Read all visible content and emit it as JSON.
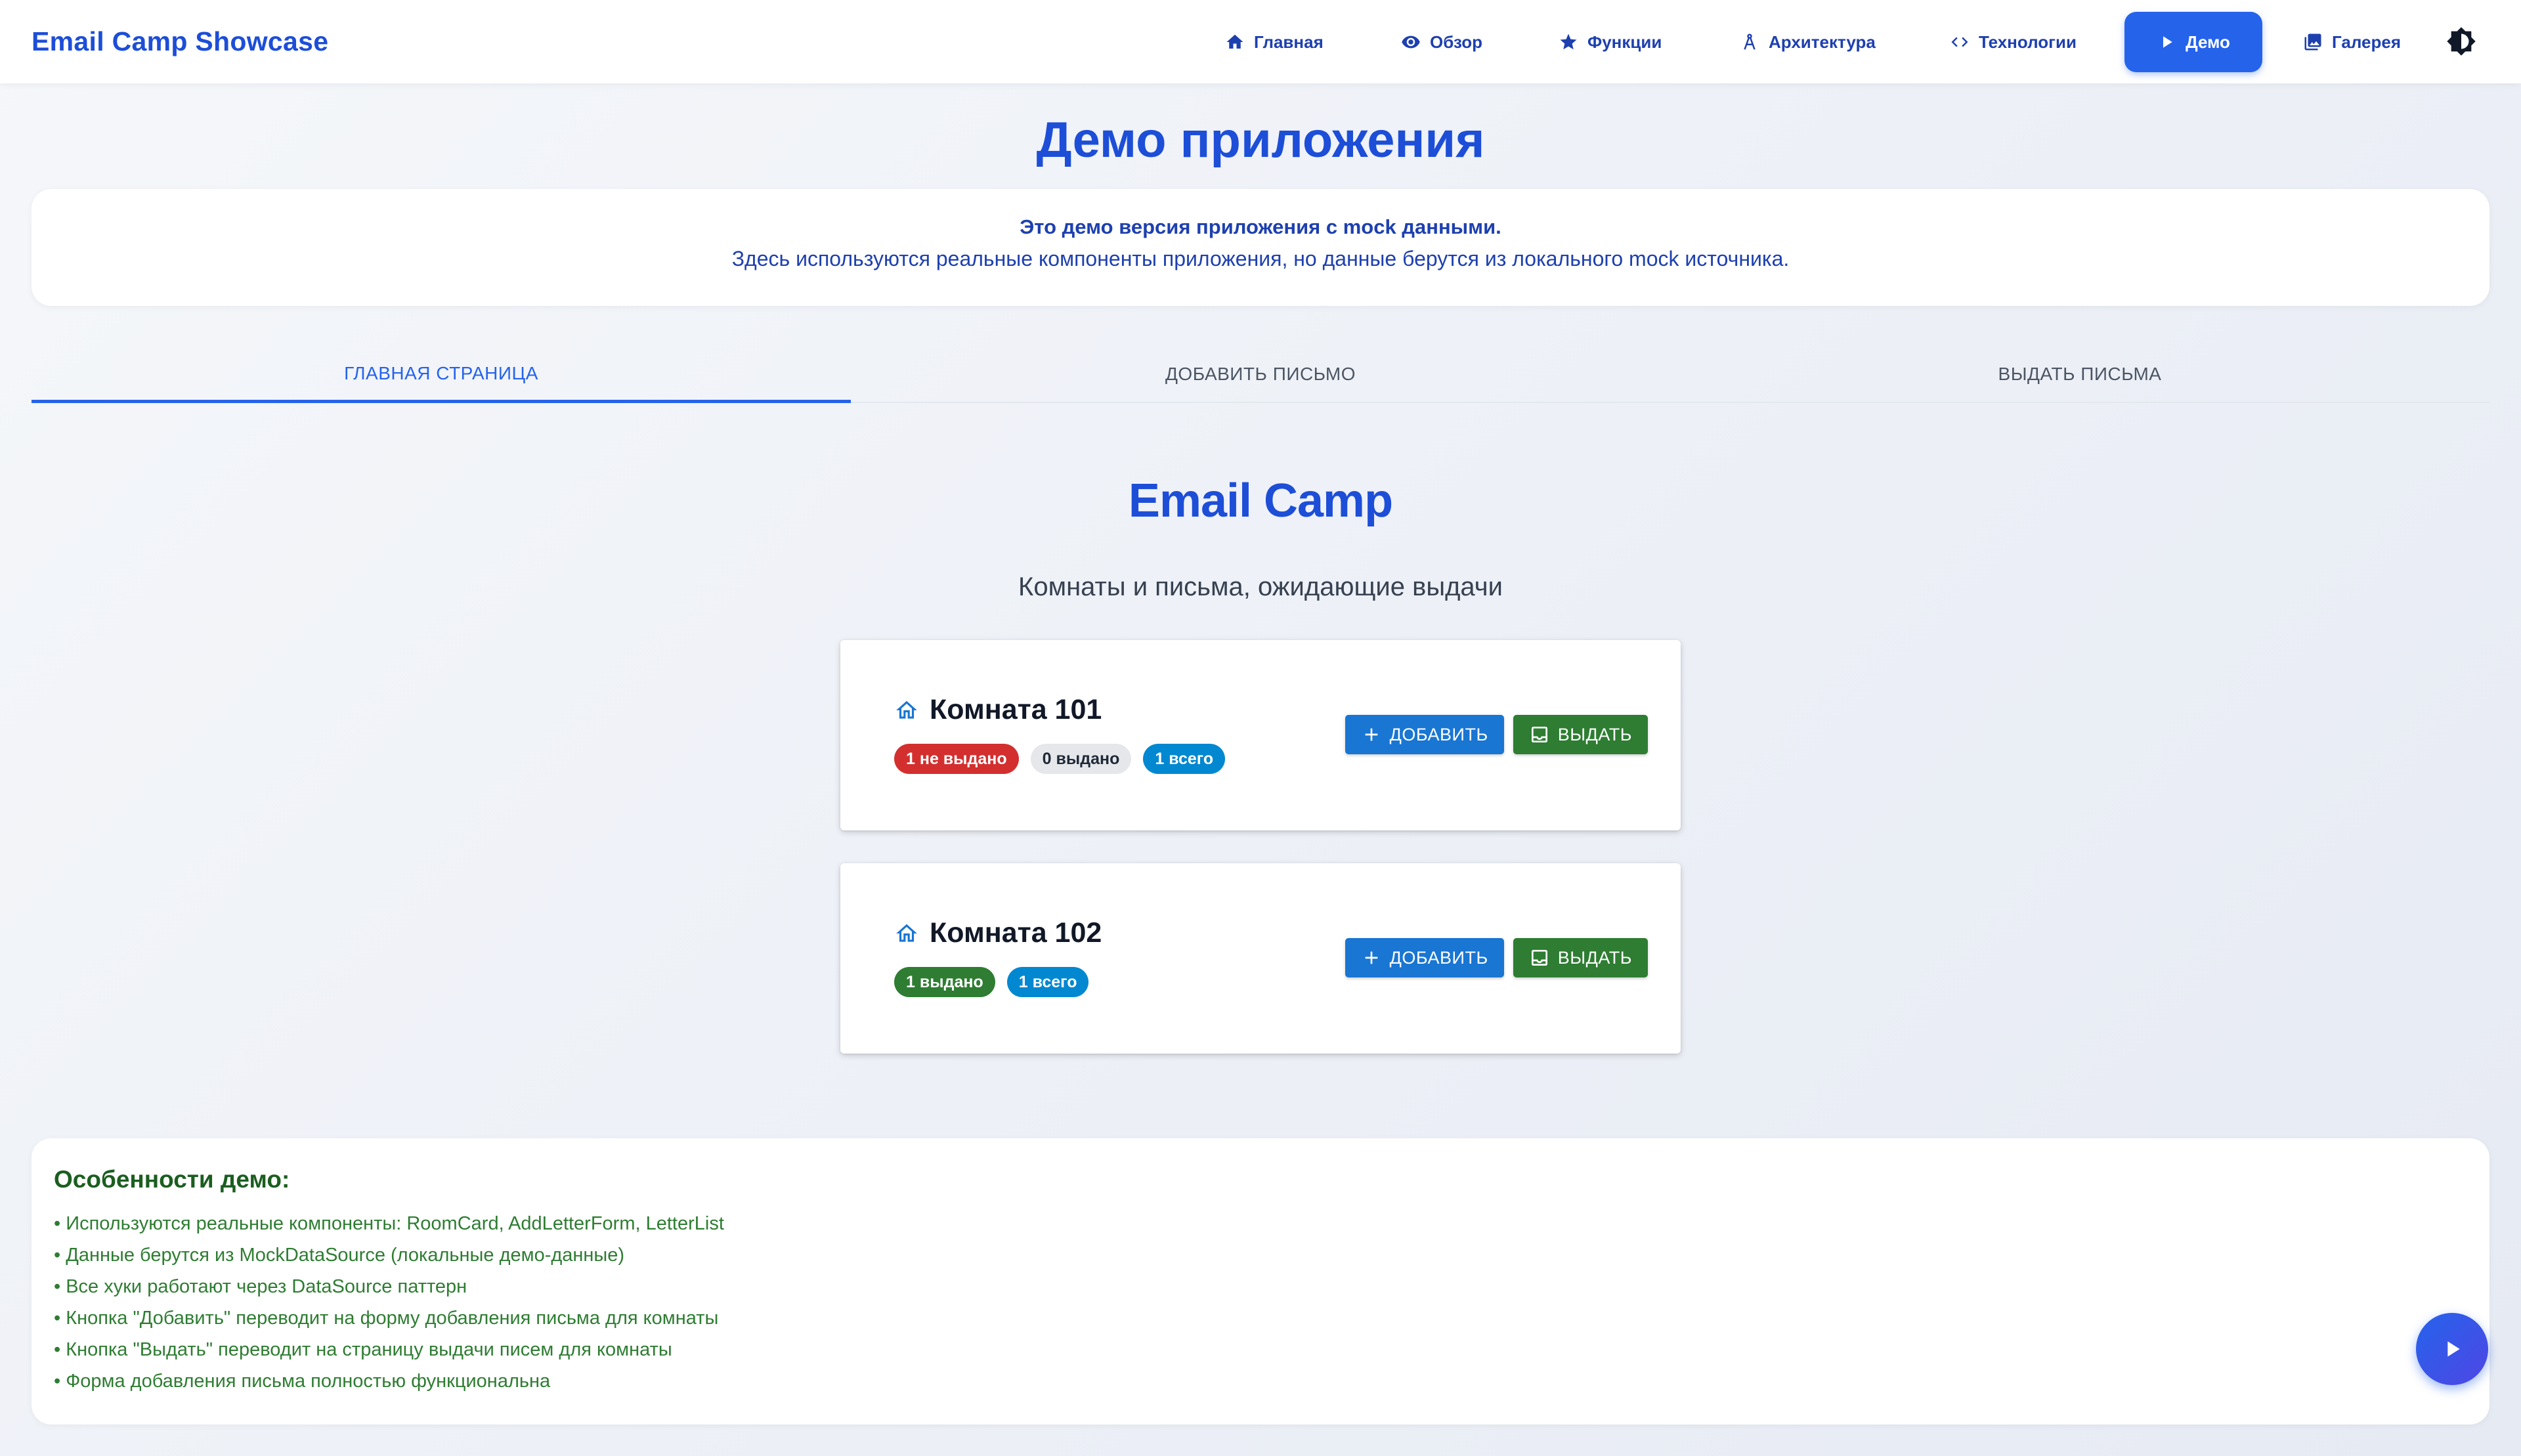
{
  "nav": {
    "brand": "Email Camp Showcase",
    "items": [
      {
        "label": "Главная",
        "icon": "home-icon"
      },
      {
        "label": "Обзор",
        "icon": "eye-icon"
      },
      {
        "label": "Функции",
        "icon": "star-icon"
      },
      {
        "label": "Архитектура",
        "icon": "compass-icon"
      },
      {
        "label": "Технологии",
        "icon": "code-icon"
      },
      {
        "label": "Демо",
        "icon": "play-icon",
        "active": true
      },
      {
        "label": "Галерея",
        "icon": "gallery-icon"
      }
    ],
    "theme_icon": "theme-toggle-icon"
  },
  "page": {
    "title": "Демо приложения",
    "info_line1": "Это демо версия приложения с mock данными.",
    "info_line2": "Здесь используются реальные компоненты приложения, но данные берутся из локального mock источника."
  },
  "tabs": [
    {
      "label": "Главная страница",
      "active": true
    },
    {
      "label": "Добавить письмо",
      "active": false
    },
    {
      "label": "Выдать письма",
      "active": false
    }
  ],
  "app": {
    "title": "Email Camp",
    "subtitle": "Комнаты и письма, ожидающие выдачи",
    "rooms": [
      {
        "name": "Комната 101",
        "badges": [
          {
            "text": "1 не выдано",
            "color": "#d32f2f"
          },
          {
            "text": "0 выдано",
            "color": "#e5e7eb"
          },
          {
            "text": "1 всего",
            "color": "#0288d1"
          }
        ],
        "add_label": "Добавить",
        "issue_label": "Выдать"
      },
      {
        "name": "Комната 102",
        "badges": [
          {
            "text": "1 выдано",
            "color": "#2e7d32"
          },
          {
            "text": "1 всего",
            "color": "#0288d1"
          }
        ],
        "add_label": "Добавить",
        "issue_label": "Выдать"
      }
    ]
  },
  "features": {
    "title": "Особенности демо:",
    "items": [
      "Используются реальные компоненты: RoomCard, AddLetterForm, LetterList",
      "Данные берутся из MockDataSource (локальные демо-данные)",
      "Все хуки работают через DataSource паттерн",
      "Кнопка \"Добавить\" переводит на форму добавления письма для комнаты",
      "Кнопка \"Выдать\" переводит на страницу выдачи писем для комнаты",
      "Форма добавления письма полностью функциональна"
    ]
  },
  "fab": {
    "icon": "play-icon"
  },
  "colors": {
    "primary": "#2563eb",
    "heading": "#1d4ed8",
    "success": "#2e7d32",
    "danger": "#d32f2f",
    "info": "#0288d1",
    "add_button": "#1976d2"
  }
}
